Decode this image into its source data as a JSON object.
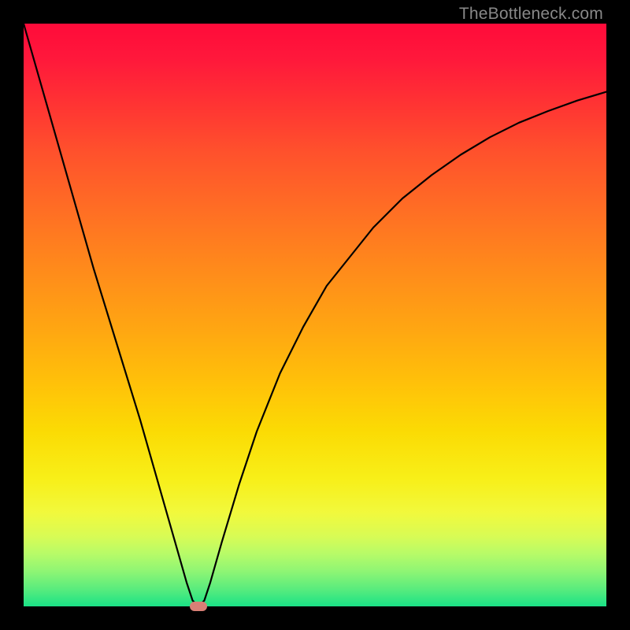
{
  "watermark": "TheBottleneck.com",
  "colors": {
    "frame": "#000000",
    "curve": "#000000",
    "marker": "#d97f76",
    "watermark": "#888888"
  },
  "chart_data": {
    "type": "line",
    "title": "",
    "xlabel": "",
    "ylabel": "",
    "xlim": [
      0,
      100
    ],
    "ylim": [
      0,
      100
    ],
    "series": [
      {
        "name": "bottleneck-curve",
        "x": [
          0,
          4,
          8,
          12,
          16,
          20,
          24,
          26,
          28,
          29,
          30,
          31,
          32,
          34,
          37,
          40,
          44,
          48,
          52,
          56,
          60,
          65,
          70,
          75,
          80,
          85,
          90,
          95,
          100
        ],
        "values": [
          100,
          86,
          72,
          58,
          45,
          32,
          18,
          11,
          4,
          1,
          0,
          1,
          4,
          11,
          21,
          30,
          40,
          48,
          55,
          60,
          65,
          70,
          74,
          77.5,
          80.5,
          83,
          85,
          86.8,
          88.3
        ]
      }
    ],
    "marker": {
      "x": 30,
      "y": 0
    },
    "annotations": []
  }
}
